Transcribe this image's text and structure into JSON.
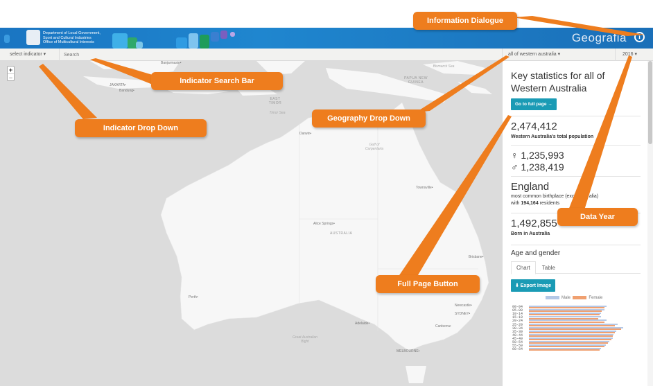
{
  "header": {
    "dept_line1": "Department of Local Government,",
    "dept_line2": "Sport and Cultural Industries",
    "dept_line3": "Office of Multicultural Interests",
    "brand": "Geografia",
    "info_icon": "info-icon",
    "accent_color": "#1a75c2"
  },
  "toolbar": {
    "indicator_label": "select indicator ▾",
    "search_placeholder": "Search",
    "geography_label": "all of western australia ▾",
    "year_label": "2016 ▾"
  },
  "map": {
    "zoom_in": "+",
    "zoom_out": "–",
    "labels": {
      "banjarmasin": "Banjarmasin•",
      "jakarta": "JAKARTA•",
      "bandung": "Bandung•",
      "bismarck": "Bismarck Sea",
      "png": "PAPUA NEW GUINEA",
      "timor": "EAST TIMOR",
      "timor_sea": "Timor Sea",
      "darwin": "Darwin•",
      "carpentaria": "Gulf of Carpentaria",
      "townsville": "Townsville•",
      "alice": "Alice Springs•",
      "australia": "AUSTRALIA",
      "brisbane": "Brisbane•",
      "perth": "Perth•",
      "adelaide": "Adelaide•",
      "newcastle": "Newcastle•",
      "sydney": "SYDNEY•",
      "canberra": "Canberra•",
      "melbourne": "MELBOURNE•",
      "bight": "Great Australian Bight"
    },
    "land_color": "#f7f7f7",
    "sea_color": "#dcdcdc"
  },
  "panel": {
    "title": "Key statistics for all of Western Australia",
    "full_page_button": "Go to full page →",
    "population": "2,474,412",
    "population_label": "Western Australia's total population",
    "female": "♀ 1,235,993",
    "male": "♂ 1,238,419",
    "birthplace": "England",
    "birthplace_desc": "most common birthplace (excl. Australia)",
    "birthplace_count_prefix": "with ",
    "birthplace_count": "194,164",
    "birthplace_count_suffix": " residents",
    "born_aus": "1,492,855",
    "born_aus_label": "Born in Australia",
    "age_gender_title": "Age and gender",
    "tab_chart": "Chart",
    "tab_table": "Table",
    "export_button": "⬇ Export Image",
    "teal_color": "#1a9bb5"
  },
  "chart_data": {
    "type": "bar",
    "series": [
      {
        "name": "Male",
        "color": "#b4c8e6",
        "values": [
          6.6,
          6.4,
          6.1,
          6.1,
          6.6,
          7.5,
          8.0,
          7.4,
          7.2,
          7.1,
          6.8,
          6.5,
          6.1
        ]
      },
      {
        "name": "Female",
        "color": "#f0a070",
        "values": [
          6.4,
          6.2,
          6.0,
          5.9,
          6.4,
          7.3,
          7.8,
          7.3,
          7.1,
          7.0,
          6.7,
          6.4,
          6.0
        ]
      }
    ],
    "categories": [
      "00-04",
      "05-09",
      "10-14",
      "15-19",
      "20-24",
      "25-29",
      "30-34",
      "35-39",
      "40-44",
      "45-49",
      "50-54",
      "55-59",
      "60-64"
    ],
    "legend_position": "top"
  },
  "annotations": {
    "info": "Information Dialogue",
    "search": "Indicator Search Bar",
    "indicator": "Indicator Drop Down",
    "geography": "Geography Drop Down",
    "full_page": "Full Page Button",
    "year": "Data Year",
    "color": "#ee7d1e"
  }
}
